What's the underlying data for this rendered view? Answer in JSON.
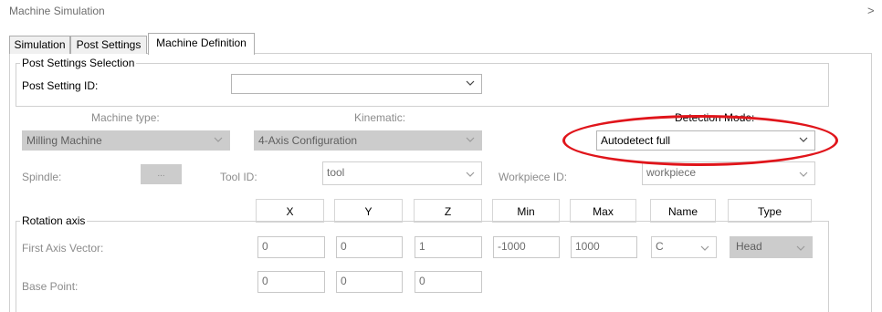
{
  "window": {
    "title": "Machine Simulation",
    "close_glyph": ">"
  },
  "tabs": [
    "Simulation",
    "Post Settings",
    "Machine Definition"
  ],
  "active_tab": "Machine Definition",
  "post_settings_group": {
    "legend": "Post Settings Selection",
    "post_setting_id_label": "Post Setting ID:",
    "post_setting_id_value": ""
  },
  "machine": {
    "machine_type_label": "Machine type:",
    "machine_type_value": "Milling Machine",
    "kinematic_label": "Kinematic:",
    "kinematic_value": "4-Axis Configuration",
    "detection_mode_label": "Detection Mode:",
    "detection_mode_value": "Autodetect full"
  },
  "tools": {
    "spindle_label": "Spindle:",
    "spindle_button": "...",
    "tool_id_label": "Tool ID:",
    "tool_id_value": "tool",
    "workpiece_id_label": "Workpiece ID:",
    "workpiece_id_value": "workpiece"
  },
  "columns": [
    "X",
    "Y",
    "Z",
    "Min",
    "Max",
    "Name",
    "Type"
  ],
  "rotation_axis": {
    "legend": "Rotation axis",
    "first_axis_vector_label": "First Axis Vector:",
    "first_axis_vector": {
      "x": "0",
      "y": "0",
      "z": "1",
      "min": "-1000",
      "max": "1000",
      "name": "C",
      "type": "Head"
    },
    "base_point_label": "Base Point:",
    "base_point": {
      "x": "0",
      "y": "0",
      "z": "0"
    }
  },
  "annotation": {
    "color": "#e0151b",
    "shape": "ellipse"
  }
}
